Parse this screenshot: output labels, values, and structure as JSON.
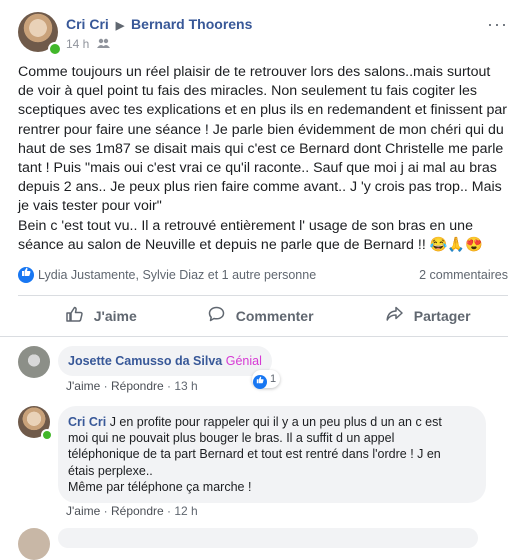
{
  "post": {
    "author": "Cri Cri",
    "target": "Bernard Thoorens",
    "time": "14 h",
    "menu": "···",
    "text": "Comme toujours un réel plaisir de te retrouver lors des salons..mais surtout\nde voir à quel point tu fais des miracles. Non seulement tu fais cogiter les\nsceptiques avec tes explications et en plus ils en redemandent et finissent par\nrentrer pour faire une séance ! Je parle bien évidemment de mon chéri qui du\nhaut de ses 1m87 se disait mais qui c'est ce Bernard dont Christelle me parle\ntant ! Puis \"mais oui c'est vrai ce qu'il raconte.. Sauf que moi j ai mal au bras\ndepuis 2 ans.. Je peux plus rien faire comme avant.. J 'y crois pas trop.. Mais\nje vais tester pour voir\"\nBein c 'est tout vu.. Il a retrouvé entièrement l' usage de son bras en une\nséance au salon de Neuville et depuis ne parle que de Bernard !! 😂🙏😍",
    "reactors": "Lydia Justamente, Sylvie Diaz et 1 autre personne",
    "comment_count": "2 commentaires"
  },
  "actions": {
    "like": "J'aime",
    "comment": "Commenter",
    "share": "Partager"
  },
  "comments": [
    {
      "author": "Josette Camusso da Silva",
      "text": "Génial",
      "like": "J'aime",
      "reply": "Répondre",
      "time": "13 h",
      "reaction_count": "1"
    },
    {
      "author": "Cri Cri",
      "text": "J en profite pour rappeler qui il y a un peu plus d un an c est\nmoi qui ne pouvait plus bouger le bras. Il a suffit d un appel\ntéléphonique de ta part Bernard et tout est rentré dans l'ordre ! J en\nétais perplexe..\nMême par téléphone ça marche !",
      "like": "J'aime",
      "reply": "Répondre",
      "time": "12 h"
    }
  ],
  "icons": {
    "arrow": "▶",
    "people": "friends-icon",
    "like": "👍",
    "comment": "💬",
    "share": "↪"
  },
  "colors": {
    "link": "#385898",
    "facebook_blue": "#1877f2",
    "genial": "#d63ad4",
    "online": "#42b72a"
  }
}
